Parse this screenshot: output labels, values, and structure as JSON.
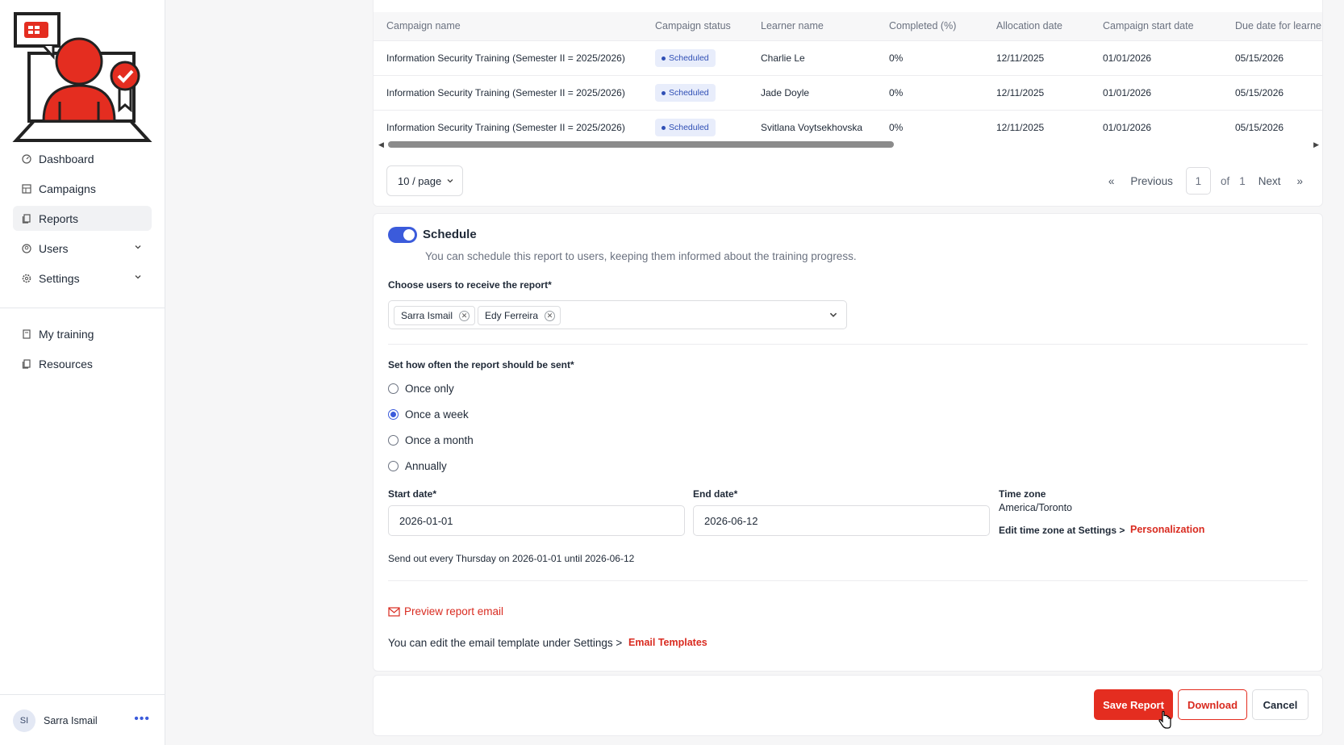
{
  "sidebar": {
    "nav": [
      {
        "label": "Dashboard",
        "icon": "gauge-icon"
      },
      {
        "label": "Campaigns",
        "icon": "grid-icon"
      },
      {
        "label": "Reports",
        "icon": "document-icon"
      },
      {
        "label": "Users",
        "icon": "user-circle-icon"
      },
      {
        "label": "Settings",
        "icon": "gear-icon"
      }
    ],
    "nav2": [
      {
        "label": "My training",
        "icon": "book-icon"
      },
      {
        "label": "Resources",
        "icon": "files-icon"
      }
    ],
    "user": {
      "initials": "SI",
      "name": "Sarra Ismail"
    }
  },
  "table": {
    "columns": [
      "Campaign name",
      "Campaign status",
      "Learner name",
      "Completed (%)",
      "Allocation date",
      "Campaign start date",
      "Due date for learne"
    ],
    "rows": [
      {
        "campaign": "Information Security Training (Semester II = 2025/2026)",
        "status": "Scheduled",
        "learner": "Charlie Le",
        "completed": "0%",
        "allocation": "12/11/2025",
        "start": "01/01/2026",
        "due": "05/15/2026"
      },
      {
        "campaign": "Information Security Training (Semester II = 2025/2026)",
        "status": "Scheduled",
        "learner": "Jade Doyle",
        "completed": "0%",
        "allocation": "12/11/2025",
        "start": "01/01/2026",
        "due": "05/15/2026"
      },
      {
        "campaign": "Information Security Training (Semester II = 2025/2026)",
        "status": "Scheduled",
        "learner": "Svitlana Voytsekhovska",
        "completed": "0%",
        "allocation": "12/11/2025",
        "start": "01/01/2026",
        "due": "05/15/2026"
      }
    ],
    "page_size": "10 / page",
    "pager": {
      "previous": "Previous",
      "page": "1",
      "of": "of",
      "total": "1",
      "next": "Next"
    }
  },
  "schedule": {
    "title": "Schedule",
    "enabled": true,
    "description": "You can schedule this report to users, keeping them informed about the training progress.",
    "recipients_label": "Choose users to receive the report*",
    "recipients": [
      "Sarra Ismail",
      "Edy Ferreira"
    ],
    "frequency_label": "Set how often the report should be sent*",
    "frequencies": [
      "Once only",
      "Once a week",
      "Once a month",
      "Annually"
    ],
    "selected_frequency": "Once a week",
    "start_label": "Start date*",
    "start_value": "2026-01-01",
    "end_label": "End date*",
    "end_value": "2026-06-12",
    "tz_label": "Time zone",
    "tz_value": "America/Toronto",
    "tz_edit_text": "Edit time zone at Settings >",
    "tz_edit_link": "Personalization",
    "summary": "Send out every Thursday on 2026-01-01 until 2026-06-12",
    "preview_link": "Preview report email",
    "template_text": "You can edit the email template under Settings >",
    "template_link": "Email Templates"
  },
  "footer": {
    "save": "Save Report",
    "download": "Download",
    "cancel": "Cancel"
  },
  "colors": {
    "accent_red": "#e42d20",
    "accent_blue": "#3b5bdb"
  }
}
